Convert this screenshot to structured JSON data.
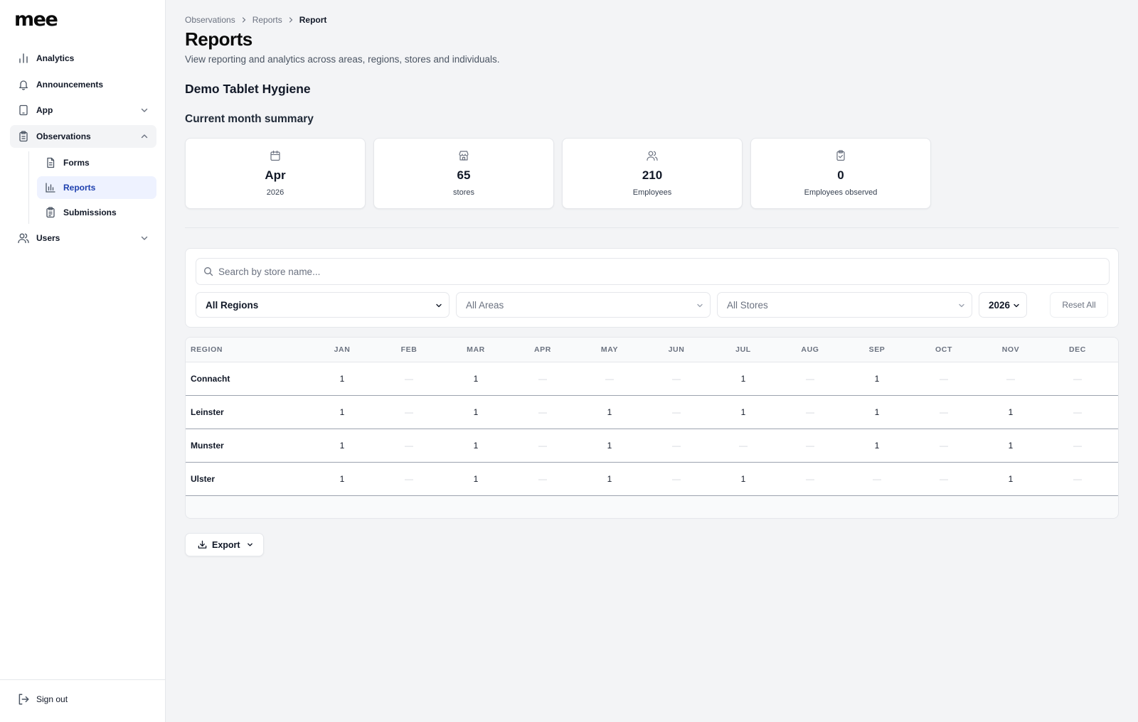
{
  "app": {
    "logo": "mee"
  },
  "sidebar": {
    "items": [
      {
        "label": "Analytics",
        "icon": "bar-chart-icon"
      },
      {
        "label": "Announcements",
        "icon": "bell-icon"
      },
      {
        "label": "App",
        "icon": "tablet-icon"
      },
      {
        "label": "Observations",
        "icon": "clipboard-icon"
      },
      {
        "label": "Users",
        "icon": "users-icon"
      }
    ],
    "observations_sub": [
      {
        "label": "Forms",
        "icon": "document-icon"
      },
      {
        "label": "Reports",
        "icon": "bar-chart-icon"
      },
      {
        "label": "Submissions",
        "icon": "clipboard-list-icon"
      }
    ],
    "sign_out": "Sign out"
  },
  "breadcrumb": [
    "Observations",
    "Reports",
    "Report"
  ],
  "page": {
    "title": "Reports",
    "subtitle": "View reporting and analytics across areas, regions, stores and individuals.",
    "form_name": "Demo Tablet Hygiene",
    "summary_heading": "Current month summary"
  },
  "summary_cards": [
    {
      "value": "Apr",
      "label": "2026",
      "icon": "calendar-icon"
    },
    {
      "value": "65",
      "label": "stores",
      "icon": "store-icon"
    },
    {
      "value": "210",
      "label": "Employees",
      "icon": "users-icon"
    },
    {
      "value": "0",
      "label": "Employees observed",
      "icon": "clipboard-check-icon"
    }
  ],
  "filters": {
    "search_placeholder": "Search by store name...",
    "region": "All Regions",
    "area": "All Areas",
    "store": "All Stores",
    "year": "2026",
    "reset_label": "Reset All"
  },
  "table": {
    "columns": [
      "REGION",
      "JAN",
      "FEB",
      "MAR",
      "APR",
      "MAY",
      "JUN",
      "JUL",
      "AUG",
      "SEP",
      "OCT",
      "NOV",
      "DEC"
    ],
    "rows": [
      {
        "region": "Connacht",
        "values": [
          "1",
          "—",
          "1",
          "—",
          "—",
          "—",
          "1",
          "—",
          "1",
          "—",
          "—",
          "—"
        ]
      },
      {
        "region": "Leinster",
        "values": [
          "1",
          "—",
          "1",
          "—",
          "1",
          "—",
          "1",
          "—",
          "1",
          "—",
          "1",
          "—"
        ]
      },
      {
        "region": "Munster",
        "values": [
          "1",
          "—",
          "1",
          "—",
          "1",
          "—",
          "—",
          "—",
          "1",
          "—",
          "1",
          "—"
        ]
      },
      {
        "region": "Ulster",
        "values": [
          "1",
          "—",
          "1",
          "—",
          "1",
          "—",
          "1",
          "—",
          "—",
          "—",
          "1",
          "—"
        ]
      }
    ]
  },
  "export": {
    "label": "Export"
  },
  "colors": {
    "active_text": "#1e40af",
    "active_bg": "#eef2ff",
    "page_bg": "#f3f4f6"
  }
}
